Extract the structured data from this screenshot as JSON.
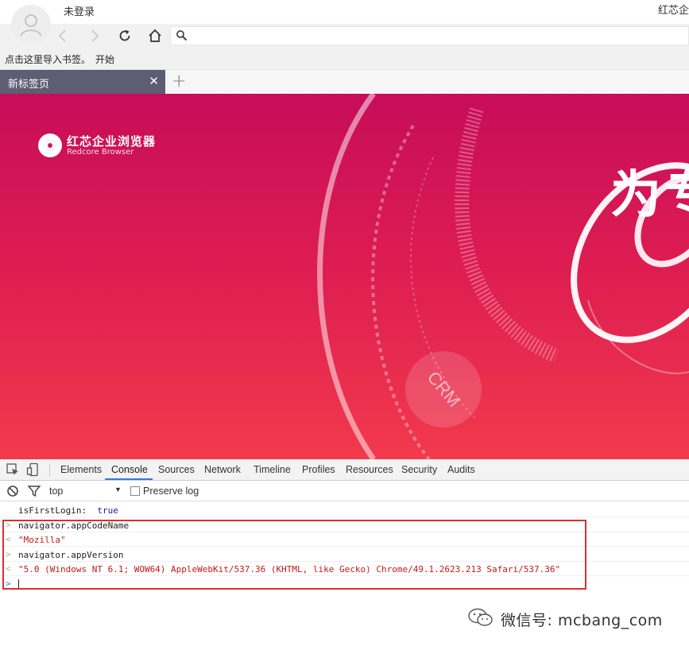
{
  "titlebar": {
    "user_label": "未登录",
    "brand_label": "红芯企"
  },
  "navbar": {
    "back": "chevron-left-icon",
    "forward": "chevron-right-icon",
    "reload": "reload-icon",
    "home": "home-icon",
    "address_value": ""
  },
  "bookmarks": {
    "prompt": "点击这里导入书签。",
    "start": "开始"
  },
  "tabs": [
    {
      "title": "新标签页",
      "close": "✕"
    }
  ],
  "new_tab": "+",
  "page": {
    "logo_cn": "红芯企业浏览器",
    "logo_en": "Redcore Browser",
    "slogan": "为专",
    "crm": "CRM",
    "colors": {
      "gradient_top": "#c70d5a",
      "gradient_bottom": "#f23a4c"
    }
  },
  "devtools": {
    "tabs": [
      "Elements",
      "Console",
      "Sources",
      "Network",
      "Timeline",
      "Profiles",
      "Resources",
      "Security",
      "Audits"
    ],
    "active_tab": "Console",
    "context": "top",
    "preserve_log": "Preserve log",
    "console": [
      {
        "kind": "log",
        "key": "isFirstLogin:",
        "value": "true"
      },
      {
        "kind": "input",
        "text": "navigator.appCodeName"
      },
      {
        "kind": "output",
        "text": "\"Mozilla\""
      },
      {
        "kind": "input",
        "text": "navigator.appVersion"
      },
      {
        "kind": "output",
        "text": "\"5.0 (Windows NT 6.1; WOW64) AppleWebKit/537.36 (KHTML, like Gecko) Chrome/49.1.2623.213 Safari/537.36\""
      }
    ],
    "accent": "#3879d9",
    "highlight_color": "#e02d2d"
  },
  "watermark": {
    "text": "微信号: mcbang_com"
  }
}
